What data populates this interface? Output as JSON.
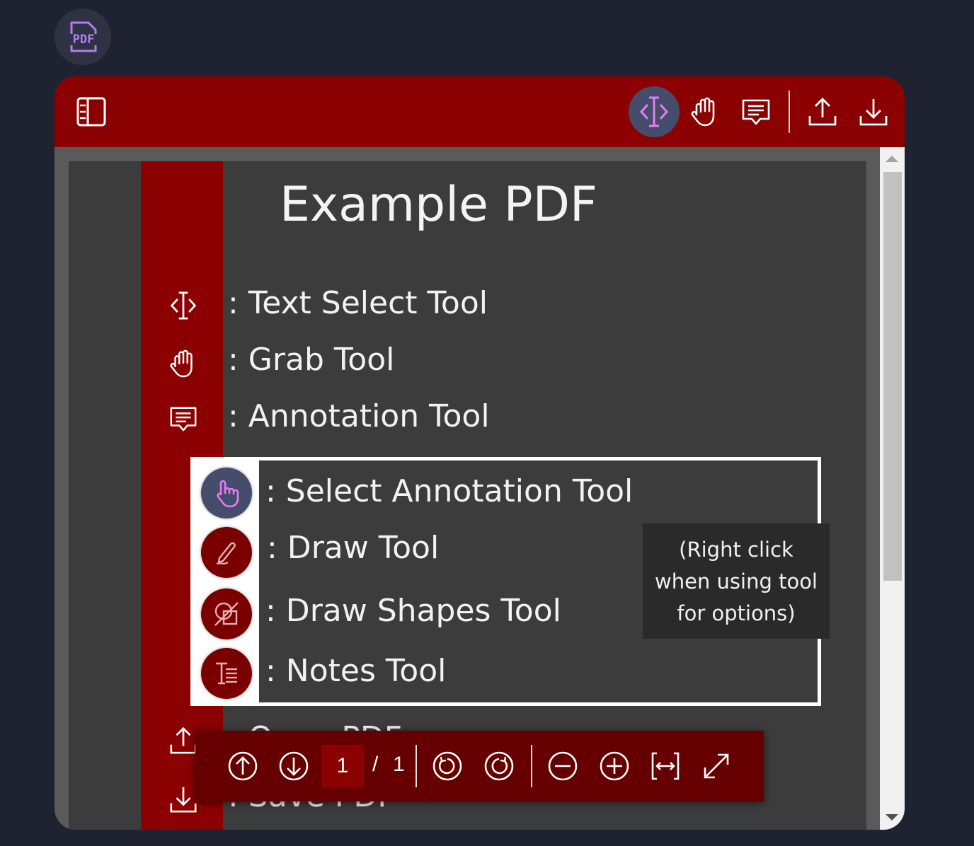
{
  "app": {
    "badge_label": "PDF"
  },
  "toolbar": {
    "tools": [
      {
        "name": "text-select",
        "active": true
      },
      {
        "name": "grab"
      },
      {
        "name": "annotation"
      },
      {
        "name": "open"
      },
      {
        "name": "save"
      }
    ]
  },
  "document": {
    "title": "Example PDF",
    "rows": {
      "text_select": ": Text Select Tool",
      "grab": ": Grab Tool",
      "annotation": ": Annotation Tool",
      "open": ": Open PDF",
      "save": ": Save PDF"
    },
    "annotation_tools": {
      "select": ": Select Annotation Tool",
      "draw": ": Draw Tool",
      "shapes": ": Draw Shapes Tool",
      "notes": ": Notes Tool"
    },
    "tooltip": {
      "line1": "(Right click",
      "line2": "when using tool",
      "line3": "for options)"
    }
  },
  "navigation": {
    "current_page": "1",
    "separator": "/",
    "total_pages": "1"
  },
  "colors": {
    "accent": "#8b0000",
    "active": "#454c6c",
    "background": "#1f2231"
  }
}
